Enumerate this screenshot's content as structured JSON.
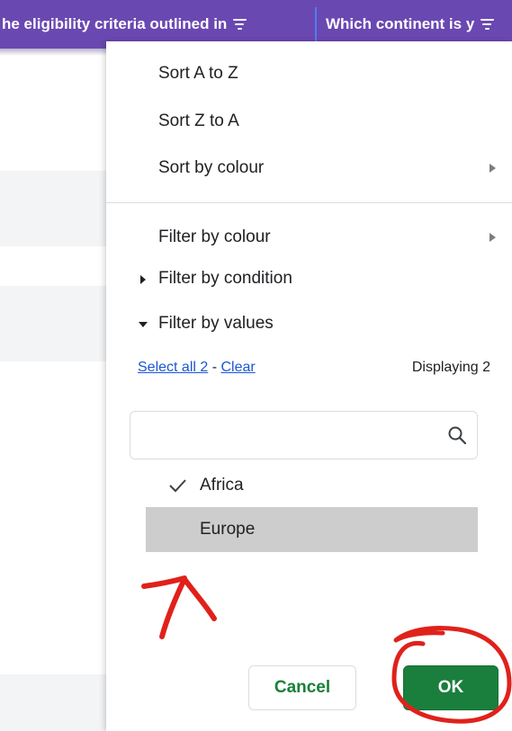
{
  "header": {
    "col1_title": "he eligibility criteria outlined in",
    "col2_title": "Which continent is y"
  },
  "menu": {
    "sort_a_z": "Sort A to Z",
    "sort_z_a": "Sort Z to A",
    "sort_by_colour": "Sort by colour",
    "filter_by_colour": "Filter by colour",
    "filter_by_condition": "Filter by condition",
    "filter_by_values": "Filter by values",
    "select_all": "Select all 2",
    "dash": " - ",
    "clear": "Clear",
    "displaying": "Displaying 2",
    "search_placeholder": "",
    "values": [
      {
        "label": "Africa",
        "checked": true,
        "highlighted": false
      },
      {
        "label": "Europe",
        "checked": false,
        "highlighted": true
      }
    ],
    "cancel_label": "Cancel",
    "ok_label": "OK"
  },
  "colors": {
    "header_bg": "#6a48b1",
    "link": "#1a57d6",
    "ok_bg": "#1a7f3c",
    "cancel_text": "#188038",
    "annotation": "#e0211b",
    "selected_row": "#cdcdcd"
  },
  "icons": [
    "filter-lines-icon",
    "submenu-arrow-icon",
    "caret-right-icon",
    "caret-down-icon",
    "search-icon",
    "checkmark-icon"
  ]
}
